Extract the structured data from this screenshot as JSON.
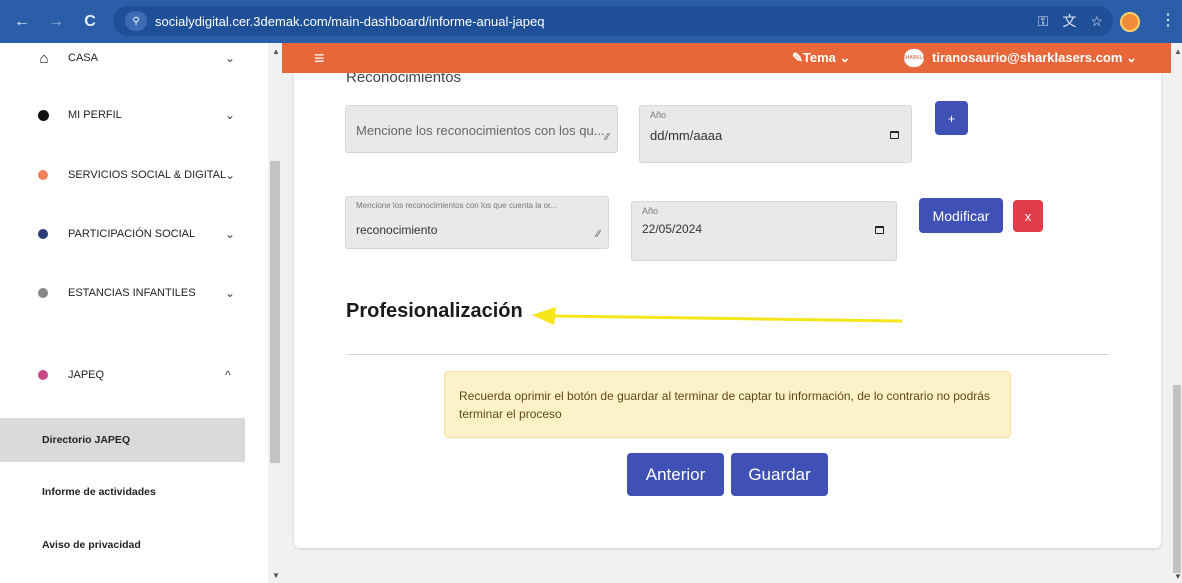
{
  "browser": {
    "url": "socialydigital.cer.3demak.com/main-dashboard/informe-anual-japeq",
    "back_icon": "←",
    "forward_icon": "→",
    "reload_icon": "C",
    "site_info_icon": "⚲",
    "key_icon": "⚿",
    "translate_icon": "文",
    "star_icon": "☆",
    "menu_icon": "⋮"
  },
  "sidebar": {
    "items": [
      {
        "label": "CASA",
        "icon": "home-icon",
        "glyph": "⌂",
        "color": "#111111",
        "chevron": "⌄"
      },
      {
        "label": "MI PERFIL",
        "icon": "user-icon",
        "glyph": "●",
        "color": "#111111",
        "chevron": "⌄"
      },
      {
        "label": "SERVICIOS SOCIAL & DIGITAL",
        "icon": "service-icon",
        "glyph": "●",
        "color": "#f0825a",
        "chevron": "⌄"
      },
      {
        "label": "PARTICIPACIÓN SOCIAL",
        "icon": "participation-icon",
        "glyph": "●",
        "color": "#2a3d7a",
        "chevron": "⌄"
      },
      {
        "label": "ESTANCIAS INFANTILES",
        "icon": "childcare-icon",
        "glyph": "●",
        "color": "#888888",
        "chevron": "⌄"
      },
      {
        "label": "JAPEQ",
        "icon": "japeq-icon",
        "glyph": "●",
        "color": "#c74a8a",
        "chevron": "^"
      }
    ],
    "subitems": [
      {
        "label": "Directorio JAPEQ",
        "active": true
      },
      {
        "label": "Informe de actividades",
        "active": false
      },
      {
        "label": "Aviso de privacidad",
        "active": false
      }
    ]
  },
  "header": {
    "hamburger": "≡",
    "tema": "✎Tema ⌄",
    "avatar_text": "SHARKLA",
    "user_email": "tiranosaurio@sharklasers.com ⌄",
    "bg_color": "#e8673a"
  },
  "form": {
    "section_heading": "Reconocimientos",
    "new_row": {
      "recognition_placeholder": "Mencione los reconocimientos con los qu...",
      "year_label": "Año",
      "year_value": "dd/mm/aaaa",
      "add_label": "+"
    },
    "saved_row": {
      "recognition_label": "Mencione los reconocimientos con los que cuenta la or...",
      "recognition_value": "reconocimiento",
      "year_label": "Año",
      "year_value": "22/05/2024",
      "modify_label": "Modificar",
      "delete_label": "x"
    },
    "prof_title": "Profesionalización",
    "alert_text": "Recuerda oprimir el botón de guardar al terminar de captar tu información, de lo contrario no podrás terminar el proceso",
    "prev_label": "Anterior",
    "save_label": "Guardar"
  },
  "colors": {
    "primary": "#3f51b5",
    "danger": "#e23b4a",
    "annotation_arrow": "#f5e51b"
  }
}
